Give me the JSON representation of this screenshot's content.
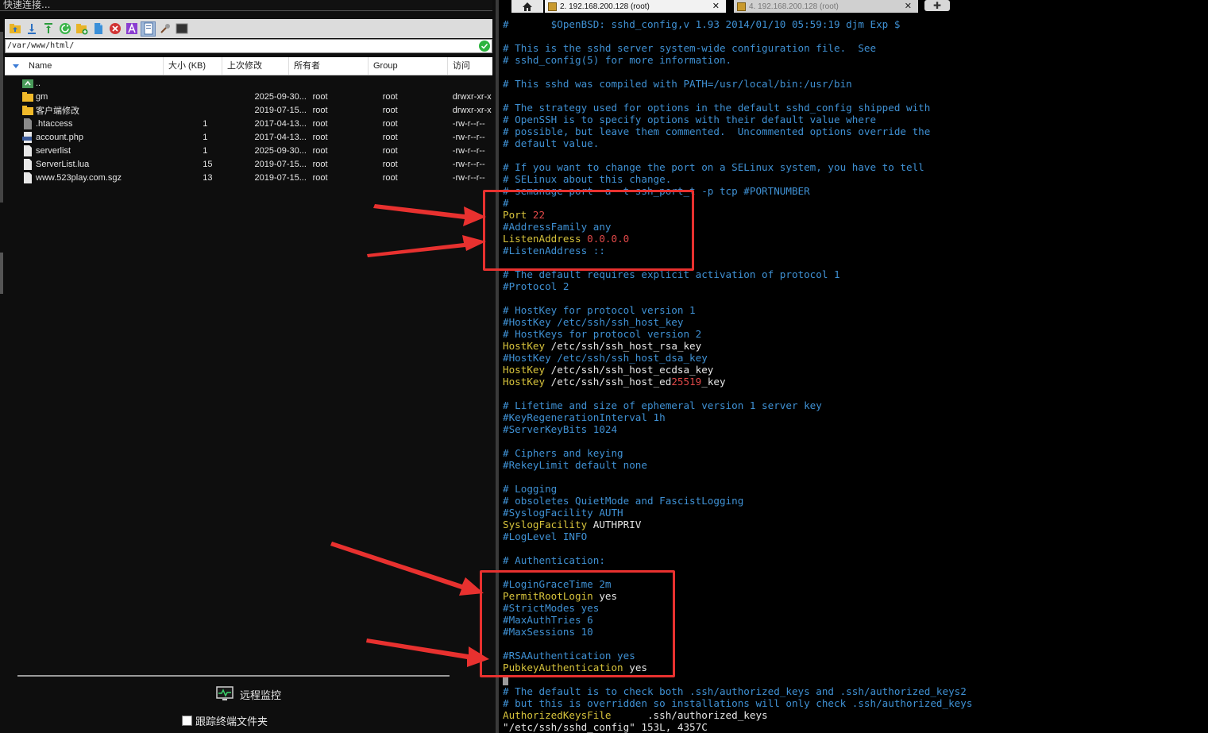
{
  "app": {
    "quickconnect_placeholder": "快速连接..."
  },
  "toolbar": {
    "icons": [
      "up-folder-icon",
      "download-icon",
      "upload-icon",
      "refresh-icon",
      "new-folder-icon",
      "new-file-icon",
      "delete-icon",
      "rename-icon",
      "file-view-icon",
      "settings-icon",
      "terminal-icon"
    ]
  },
  "path": {
    "value": "/var/www/html/"
  },
  "file_table": {
    "columns": [
      "Name",
      "大小 (KB)",
      "上次修改",
      "所有者",
      "Group",
      "访问"
    ],
    "rows": [
      {
        "icon": "parent-folder-icon",
        "name": "..",
        "size": "",
        "modified": "",
        "owner": "",
        "group": "",
        "perm": ""
      },
      {
        "icon": "folder-icon",
        "name": "gm",
        "size": "",
        "modified": "2025-09-30...",
        "owner": "root",
        "group": "root",
        "perm": "drwxr-xr-x"
      },
      {
        "icon": "folder-icon",
        "name": "客户端修改",
        "size": "",
        "modified": "2019-07-15...",
        "owner": "root",
        "group": "root",
        "perm": "drwxr-xr-x"
      },
      {
        "icon": "file-icon",
        "name": ".htaccess",
        "size": "1",
        "modified": "2017-04-13...",
        "owner": "root",
        "group": "root",
        "perm": "-rw-r--r--"
      },
      {
        "icon": "php-file-icon",
        "name": "account.php",
        "size": "1",
        "modified": "2017-04-13...",
        "owner": "root",
        "group": "root",
        "perm": "-rw-r--r--"
      },
      {
        "icon": "file-icon",
        "name": "serverlist",
        "size": "1",
        "modified": "2025-09-30...",
        "owner": "root",
        "group": "root",
        "perm": "-rw-r--r--"
      },
      {
        "icon": "file-icon",
        "name": "ServerList.lua",
        "size": "15",
        "modified": "2019-07-15...",
        "owner": "root",
        "group": "root",
        "perm": "-rw-r--r--"
      },
      {
        "icon": "file-icon",
        "name": "www.523play.com.sgz",
        "size": "13",
        "modified": "2019-07-15...",
        "owner": "root",
        "group": "root",
        "perm": "-rw-r--r--"
      }
    ]
  },
  "bottom": {
    "monitor_label": "远程监控",
    "follow_label": "跟踪终端文件夹"
  },
  "tabs": [
    {
      "label": "2. 192.168.200.128 (root)",
      "active": true
    },
    {
      "label": "4. 192.168.200.128 (root)",
      "active": false
    }
  ],
  "terminal": {
    "lines": [
      [
        {
          "c": "cm",
          "t": "#       $OpenBSD: sshd_config,v 1.93 2014/01/10 05:59:19 djm Exp $"
        }
      ],
      [],
      [
        {
          "c": "cm",
          "t": "# This is the sshd server system-wide configuration file.  See"
        }
      ],
      [
        {
          "c": "cm",
          "t": "# sshd_config(5) for more information."
        }
      ],
      [],
      [
        {
          "c": "cm",
          "t": "# This sshd was compiled with PATH=/usr/local/bin:/usr/bin"
        }
      ],
      [],
      [
        {
          "c": "cm",
          "t": "# The strategy used for options in the default sshd_config shipped with"
        }
      ],
      [
        {
          "c": "cm",
          "t": "# OpenSSH is to specify options with their default value where"
        }
      ],
      [
        {
          "c": "cm",
          "t": "# possible, but leave them commented.  Uncommented options override the"
        }
      ],
      [
        {
          "c": "cm",
          "t": "# default value."
        }
      ],
      [],
      [
        {
          "c": "cm",
          "t": "# If you want to change the port on a SELinux system, you have to tell"
        }
      ],
      [
        {
          "c": "cm",
          "t": "# SELinux about this change."
        }
      ],
      [
        {
          "c": "cm",
          "t": "# semanage port -a -t ssh_port_t -p tcp #PORTNUMBER"
        }
      ],
      [
        {
          "c": "cm",
          "t": "#"
        }
      ],
      [
        {
          "c": "kw",
          "t": "Port "
        },
        {
          "c": "num",
          "t": "22"
        }
      ],
      [
        {
          "c": "cm",
          "t": "#AddressFamily any"
        }
      ],
      [
        {
          "c": "kw",
          "t": "ListenAddress "
        },
        {
          "c": "num",
          "t": "0.0.0.0"
        }
      ],
      [
        {
          "c": "cm",
          "t": "#ListenAddress ::"
        }
      ],
      [],
      [
        {
          "c": "cm",
          "t": "# The default requires explicit activation of protocol 1"
        }
      ],
      [
        {
          "c": "cm",
          "t": "#Protocol 2"
        }
      ],
      [],
      [
        {
          "c": "cm",
          "t": "# HostKey for protocol version 1"
        }
      ],
      [
        {
          "c": "cm",
          "t": "#HostKey /etc/ssh/ssh_host_key"
        }
      ],
      [
        {
          "c": "cm",
          "t": "# HostKeys for protocol version 2"
        }
      ],
      [
        {
          "c": "kw",
          "t": "HostKey "
        },
        {
          "c": "pl",
          "t": "/etc/ssh/ssh_host_rsa_key"
        }
      ],
      [
        {
          "c": "cm",
          "t": "#HostKey /etc/ssh/ssh_host_dsa_key"
        }
      ],
      [
        {
          "c": "kw",
          "t": "HostKey "
        },
        {
          "c": "pl",
          "t": "/etc/ssh/ssh_host_ecdsa_key"
        }
      ],
      [
        {
          "c": "kw",
          "t": "HostKey "
        },
        {
          "c": "pl",
          "t": "/etc/ssh/ssh_host_ed"
        },
        {
          "c": "num",
          "t": "25519"
        },
        {
          "c": "pl",
          "t": "_key"
        }
      ],
      [],
      [
        {
          "c": "cm",
          "t": "# Lifetime and size of ephemeral version 1 server key"
        }
      ],
      [
        {
          "c": "cm",
          "t": "#KeyRegenerationInterval 1h"
        }
      ],
      [
        {
          "c": "cm",
          "t": "#ServerKeyBits 1024"
        }
      ],
      [],
      [
        {
          "c": "cm",
          "t": "# Ciphers and keying"
        }
      ],
      [
        {
          "c": "cm",
          "t": "#RekeyLimit default none"
        }
      ],
      [],
      [
        {
          "c": "cm",
          "t": "# Logging"
        }
      ],
      [
        {
          "c": "cm",
          "t": "# obsoletes QuietMode and FascistLogging"
        }
      ],
      [
        {
          "c": "cm",
          "t": "#SyslogFacility AUTH"
        }
      ],
      [
        {
          "c": "kw",
          "t": "SyslogFacility "
        },
        {
          "c": "pl",
          "t": "AUTHPRIV"
        }
      ],
      [
        {
          "c": "cm",
          "t": "#LogLevel INFO"
        }
      ],
      [],
      [
        {
          "c": "cm",
          "t": "# Authentication:"
        }
      ],
      [],
      [
        {
          "c": "cm",
          "t": "#LoginGraceTime 2m"
        }
      ],
      [
        {
          "c": "kw",
          "t": "PermitRootLogin "
        },
        {
          "c": "pl",
          "t": "yes"
        }
      ],
      [
        {
          "c": "cm",
          "t": "#StrictModes yes"
        }
      ],
      [
        {
          "c": "cm",
          "t": "#MaxAuthTries 6"
        }
      ],
      [
        {
          "c": "cm",
          "t": "#MaxSessions 10"
        }
      ],
      [],
      [
        {
          "c": "cm",
          "t": "#RSAAuthentication yes"
        }
      ],
      [
        {
          "c": "kw",
          "t": "PubkeyAuthentication "
        },
        {
          "c": "pl",
          "t": "yes"
        }
      ],
      [
        {
          "c": "cursor",
          "t": ""
        }
      ],
      [
        {
          "c": "cm",
          "t": "# The default is to check both .ssh/authorized_keys and .ssh/authorized_keys2"
        }
      ],
      [
        {
          "c": "cm",
          "t": "# but this is overridden so installations will only check .ssh/authorized_keys"
        }
      ],
      [
        {
          "c": "kw",
          "t": "AuthorizedKeysFile"
        },
        {
          "c": "pl",
          "t": "      .ssh/authorized_keys"
        }
      ],
      [
        {
          "c": "pl",
          "t": "\"/etc/ssh/sshd_config\" 153L, 4357C"
        }
      ]
    ]
  },
  "colors": {
    "comment": "#3f91d4",
    "keyword": "#d7c33c",
    "number": "#e04848",
    "annotation": "#e8312f"
  }
}
